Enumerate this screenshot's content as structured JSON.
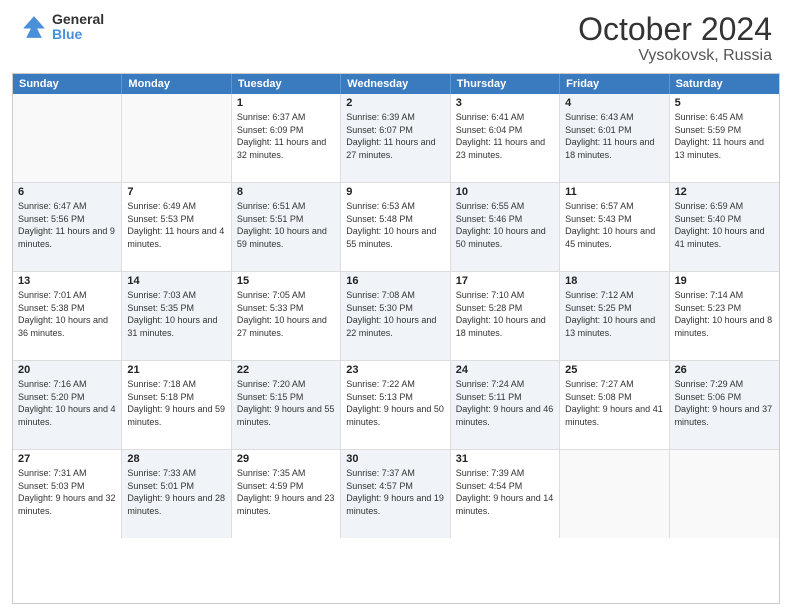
{
  "logo": {
    "general": "General",
    "blue": "Blue"
  },
  "header": {
    "month": "October 2024",
    "location": "Vysokovsk, Russia"
  },
  "weekdays": [
    "Sunday",
    "Monday",
    "Tuesday",
    "Wednesday",
    "Thursday",
    "Friday",
    "Saturday"
  ],
  "weeks": [
    [
      {
        "day": "",
        "sunrise": "",
        "sunset": "",
        "daylight": "",
        "shaded": false,
        "empty": true
      },
      {
        "day": "",
        "sunrise": "",
        "sunset": "",
        "daylight": "",
        "shaded": false,
        "empty": true
      },
      {
        "day": "1",
        "sunrise": "Sunrise: 6:37 AM",
        "sunset": "Sunset: 6:09 PM",
        "daylight": "Daylight: 11 hours and 32 minutes.",
        "shaded": false,
        "empty": false
      },
      {
        "day": "2",
        "sunrise": "Sunrise: 6:39 AM",
        "sunset": "Sunset: 6:07 PM",
        "daylight": "Daylight: 11 hours and 27 minutes.",
        "shaded": true,
        "empty": false
      },
      {
        "day": "3",
        "sunrise": "Sunrise: 6:41 AM",
        "sunset": "Sunset: 6:04 PM",
        "daylight": "Daylight: 11 hours and 23 minutes.",
        "shaded": false,
        "empty": false
      },
      {
        "day": "4",
        "sunrise": "Sunrise: 6:43 AM",
        "sunset": "Sunset: 6:01 PM",
        "daylight": "Daylight: 11 hours and 18 minutes.",
        "shaded": true,
        "empty": false
      },
      {
        "day": "5",
        "sunrise": "Sunrise: 6:45 AM",
        "sunset": "Sunset: 5:59 PM",
        "daylight": "Daylight: 11 hours and 13 minutes.",
        "shaded": false,
        "empty": false
      }
    ],
    [
      {
        "day": "6",
        "sunrise": "Sunrise: 6:47 AM",
        "sunset": "Sunset: 5:56 PM",
        "daylight": "Daylight: 11 hours and 9 minutes.",
        "shaded": true,
        "empty": false
      },
      {
        "day": "7",
        "sunrise": "Sunrise: 6:49 AM",
        "sunset": "Sunset: 5:53 PM",
        "daylight": "Daylight: 11 hours and 4 minutes.",
        "shaded": false,
        "empty": false
      },
      {
        "day": "8",
        "sunrise": "Sunrise: 6:51 AM",
        "sunset": "Sunset: 5:51 PM",
        "daylight": "Daylight: 10 hours and 59 minutes.",
        "shaded": true,
        "empty": false
      },
      {
        "day": "9",
        "sunrise": "Sunrise: 6:53 AM",
        "sunset": "Sunset: 5:48 PM",
        "daylight": "Daylight: 10 hours and 55 minutes.",
        "shaded": false,
        "empty": false
      },
      {
        "day": "10",
        "sunrise": "Sunrise: 6:55 AM",
        "sunset": "Sunset: 5:46 PM",
        "daylight": "Daylight: 10 hours and 50 minutes.",
        "shaded": true,
        "empty": false
      },
      {
        "day": "11",
        "sunrise": "Sunrise: 6:57 AM",
        "sunset": "Sunset: 5:43 PM",
        "daylight": "Daylight: 10 hours and 45 minutes.",
        "shaded": false,
        "empty": false
      },
      {
        "day": "12",
        "sunrise": "Sunrise: 6:59 AM",
        "sunset": "Sunset: 5:40 PM",
        "daylight": "Daylight: 10 hours and 41 minutes.",
        "shaded": true,
        "empty": false
      }
    ],
    [
      {
        "day": "13",
        "sunrise": "Sunrise: 7:01 AM",
        "sunset": "Sunset: 5:38 PM",
        "daylight": "Daylight: 10 hours and 36 minutes.",
        "shaded": false,
        "empty": false
      },
      {
        "day": "14",
        "sunrise": "Sunrise: 7:03 AM",
        "sunset": "Sunset: 5:35 PM",
        "daylight": "Daylight: 10 hours and 31 minutes.",
        "shaded": true,
        "empty": false
      },
      {
        "day": "15",
        "sunrise": "Sunrise: 7:05 AM",
        "sunset": "Sunset: 5:33 PM",
        "daylight": "Daylight: 10 hours and 27 minutes.",
        "shaded": false,
        "empty": false
      },
      {
        "day": "16",
        "sunrise": "Sunrise: 7:08 AM",
        "sunset": "Sunset: 5:30 PM",
        "daylight": "Daylight: 10 hours and 22 minutes.",
        "shaded": true,
        "empty": false
      },
      {
        "day": "17",
        "sunrise": "Sunrise: 7:10 AM",
        "sunset": "Sunset: 5:28 PM",
        "daylight": "Daylight: 10 hours and 18 minutes.",
        "shaded": false,
        "empty": false
      },
      {
        "day": "18",
        "sunrise": "Sunrise: 7:12 AM",
        "sunset": "Sunset: 5:25 PM",
        "daylight": "Daylight: 10 hours and 13 minutes.",
        "shaded": true,
        "empty": false
      },
      {
        "day": "19",
        "sunrise": "Sunrise: 7:14 AM",
        "sunset": "Sunset: 5:23 PM",
        "daylight": "Daylight: 10 hours and 8 minutes.",
        "shaded": false,
        "empty": false
      }
    ],
    [
      {
        "day": "20",
        "sunrise": "Sunrise: 7:16 AM",
        "sunset": "Sunset: 5:20 PM",
        "daylight": "Daylight: 10 hours and 4 minutes.",
        "shaded": true,
        "empty": false
      },
      {
        "day": "21",
        "sunrise": "Sunrise: 7:18 AM",
        "sunset": "Sunset: 5:18 PM",
        "daylight": "Daylight: 9 hours and 59 minutes.",
        "shaded": false,
        "empty": false
      },
      {
        "day": "22",
        "sunrise": "Sunrise: 7:20 AM",
        "sunset": "Sunset: 5:15 PM",
        "daylight": "Daylight: 9 hours and 55 minutes.",
        "shaded": true,
        "empty": false
      },
      {
        "day": "23",
        "sunrise": "Sunrise: 7:22 AM",
        "sunset": "Sunset: 5:13 PM",
        "daylight": "Daylight: 9 hours and 50 minutes.",
        "shaded": false,
        "empty": false
      },
      {
        "day": "24",
        "sunrise": "Sunrise: 7:24 AM",
        "sunset": "Sunset: 5:11 PM",
        "daylight": "Daylight: 9 hours and 46 minutes.",
        "shaded": true,
        "empty": false
      },
      {
        "day": "25",
        "sunrise": "Sunrise: 7:27 AM",
        "sunset": "Sunset: 5:08 PM",
        "daylight": "Daylight: 9 hours and 41 minutes.",
        "shaded": false,
        "empty": false
      },
      {
        "day": "26",
        "sunrise": "Sunrise: 7:29 AM",
        "sunset": "Sunset: 5:06 PM",
        "daylight": "Daylight: 9 hours and 37 minutes.",
        "shaded": true,
        "empty": false
      }
    ],
    [
      {
        "day": "27",
        "sunrise": "Sunrise: 7:31 AM",
        "sunset": "Sunset: 5:03 PM",
        "daylight": "Daylight: 9 hours and 32 minutes.",
        "shaded": false,
        "empty": false
      },
      {
        "day": "28",
        "sunrise": "Sunrise: 7:33 AM",
        "sunset": "Sunset: 5:01 PM",
        "daylight": "Daylight: 9 hours and 28 minutes.",
        "shaded": true,
        "empty": false
      },
      {
        "day": "29",
        "sunrise": "Sunrise: 7:35 AM",
        "sunset": "Sunset: 4:59 PM",
        "daylight": "Daylight: 9 hours and 23 minutes.",
        "shaded": false,
        "empty": false
      },
      {
        "day": "30",
        "sunrise": "Sunrise: 7:37 AM",
        "sunset": "Sunset: 4:57 PM",
        "daylight": "Daylight: 9 hours and 19 minutes.",
        "shaded": true,
        "empty": false
      },
      {
        "day": "31",
        "sunrise": "Sunrise: 7:39 AM",
        "sunset": "Sunset: 4:54 PM",
        "daylight": "Daylight: 9 hours and 14 minutes.",
        "shaded": false,
        "empty": false
      },
      {
        "day": "",
        "sunrise": "",
        "sunset": "",
        "daylight": "",
        "shaded": true,
        "empty": true
      },
      {
        "day": "",
        "sunrise": "",
        "sunset": "",
        "daylight": "",
        "shaded": false,
        "empty": true
      }
    ]
  ]
}
